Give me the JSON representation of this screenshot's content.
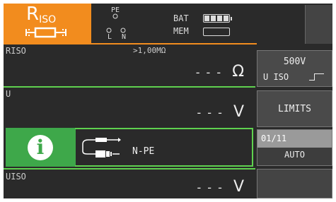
{
  "header": {
    "mode_label": "R",
    "mode_sub": "ISO",
    "pe_label": "PE",
    "l_label": "L",
    "n_label": "N",
    "bat_label": "BAT",
    "mem_label": "MEM"
  },
  "rows": {
    "riso": {
      "label": "RISO",
      "limit": ">1,00MΩ",
      "dashes": "- - -",
      "unit": "Ω"
    },
    "u": {
      "label": "U",
      "dashes": "- - -",
      "unit": "V"
    },
    "info": {
      "connection": "N-PE"
    },
    "uiso": {
      "label": "UISO",
      "dashes": "- - -",
      "unit": "V"
    }
  },
  "side": {
    "voltage": "500V",
    "voltage_param": "U ISO",
    "limits": "LIMITS",
    "counter": "01/11",
    "auto": "AUTO"
  },
  "colors": {
    "accent_orange": "#f28c1e",
    "accent_green": "#5fd14f",
    "info_green": "#3ea84a"
  }
}
